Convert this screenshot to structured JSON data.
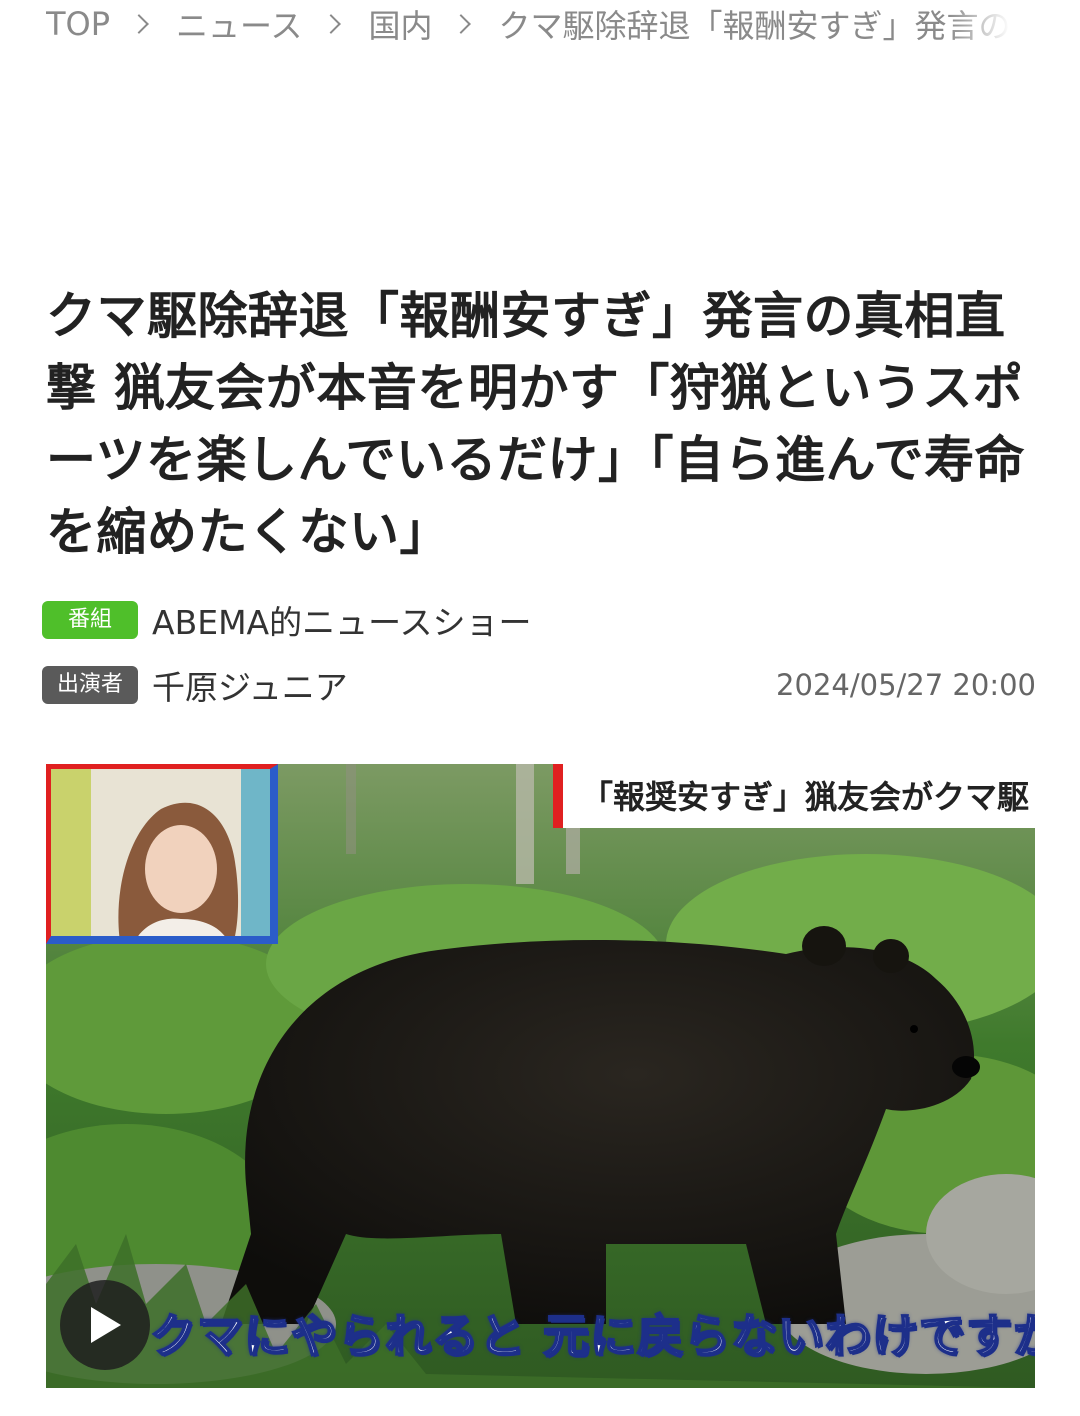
{
  "breadcrumb": {
    "items": [
      "TOP",
      "ニュース",
      "国内"
    ],
    "current": "クマ駆除辞退「報酬安すぎ」発言の"
  },
  "article": {
    "title": "クマ駆除辞退「報酬安すぎ」発言の真相直撃 猟友会が本音を明かす「狩猟というスポーツを楽しんでいるだけ」「自ら進んで寿命を縮めたくない」",
    "program_tag": "番組",
    "program_name": "ABEMA的ニュースショー",
    "cast_tag": "出演者",
    "cast_name": "千原ジュニア",
    "date": "2024/05/27 20:00"
  },
  "video": {
    "banner": "「報奨安すぎ」猟友会がクマ駆",
    "subtitle": "クマにやられると 元に戻らないわけですか",
    "play_icon": "play-icon",
    "colors": {
      "banner_accent": "#e02020",
      "pip_frame": "#2b5cc9",
      "subtitle_outline": "#1d2f8a"
    }
  },
  "colors": {
    "program_tag": "#4fbf2a",
    "cast_tag": "#5a5a5a"
  }
}
